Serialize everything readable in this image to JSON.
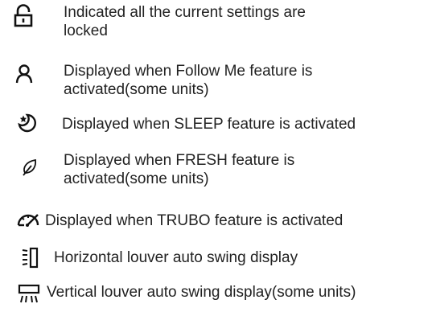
{
  "legend": {
    "items": [
      {
        "icon": "lock-icon",
        "lines": [
          "Indicated all the current settings are",
          "locked"
        ]
      },
      {
        "icon": "person-icon",
        "lines": [
          "Displayed when Follow Me feature is",
          "activated(some units)"
        ]
      },
      {
        "icon": "sleep-moon-icon",
        "lines": [
          "Displayed when SLEEP feature is activated"
        ]
      },
      {
        "icon": "leaf-icon",
        "lines": [
          "Displayed when FRESH feature is",
          "activated(some units)"
        ]
      },
      {
        "icon": "turbo-gauge-icon",
        "lines": [
          "Displayed when TRUBO feature is activated"
        ]
      },
      {
        "icon": "horizontal-louver-swing-icon",
        "lines": [
          "Horizontal louver auto swing display"
        ]
      },
      {
        "icon": "vertical-louver-swing-icon",
        "lines": [
          "Vertical louver auto swing display(some units)"
        ]
      }
    ]
  }
}
